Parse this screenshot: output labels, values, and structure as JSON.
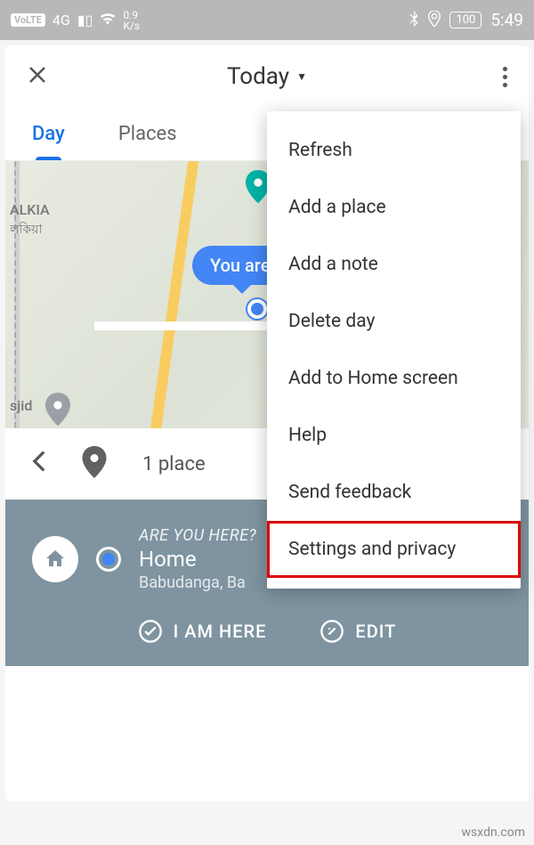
{
  "status": {
    "volte": "VoLTE",
    "signal": "4G",
    "speed": "0.9",
    "speed_unit": "K/s",
    "battery": "100",
    "time": "5:49"
  },
  "header": {
    "title": "Today"
  },
  "tabs": {
    "day": "Day",
    "places": "Places"
  },
  "map": {
    "bubble": "You are",
    "label_alkia": "ALKIA",
    "label_alkia_sub": "লকিয়া",
    "label_sjid": "sjid"
  },
  "place_bar": {
    "count": "1 place"
  },
  "here_panel": {
    "question": "ARE YOU HERE?",
    "name": "Home",
    "sub": "Babudanga, Ba",
    "action_here": "I AM HERE",
    "action_edit": "EDIT"
  },
  "menu": {
    "refresh": "Refresh",
    "add_place": "Add a place",
    "add_note": "Add a note",
    "delete_day": "Delete day",
    "add_home": "Add to Home screen",
    "help": "Help",
    "feedback": "Send feedback",
    "settings": "Settings and privacy"
  },
  "watermark": "wsxdn.com"
}
